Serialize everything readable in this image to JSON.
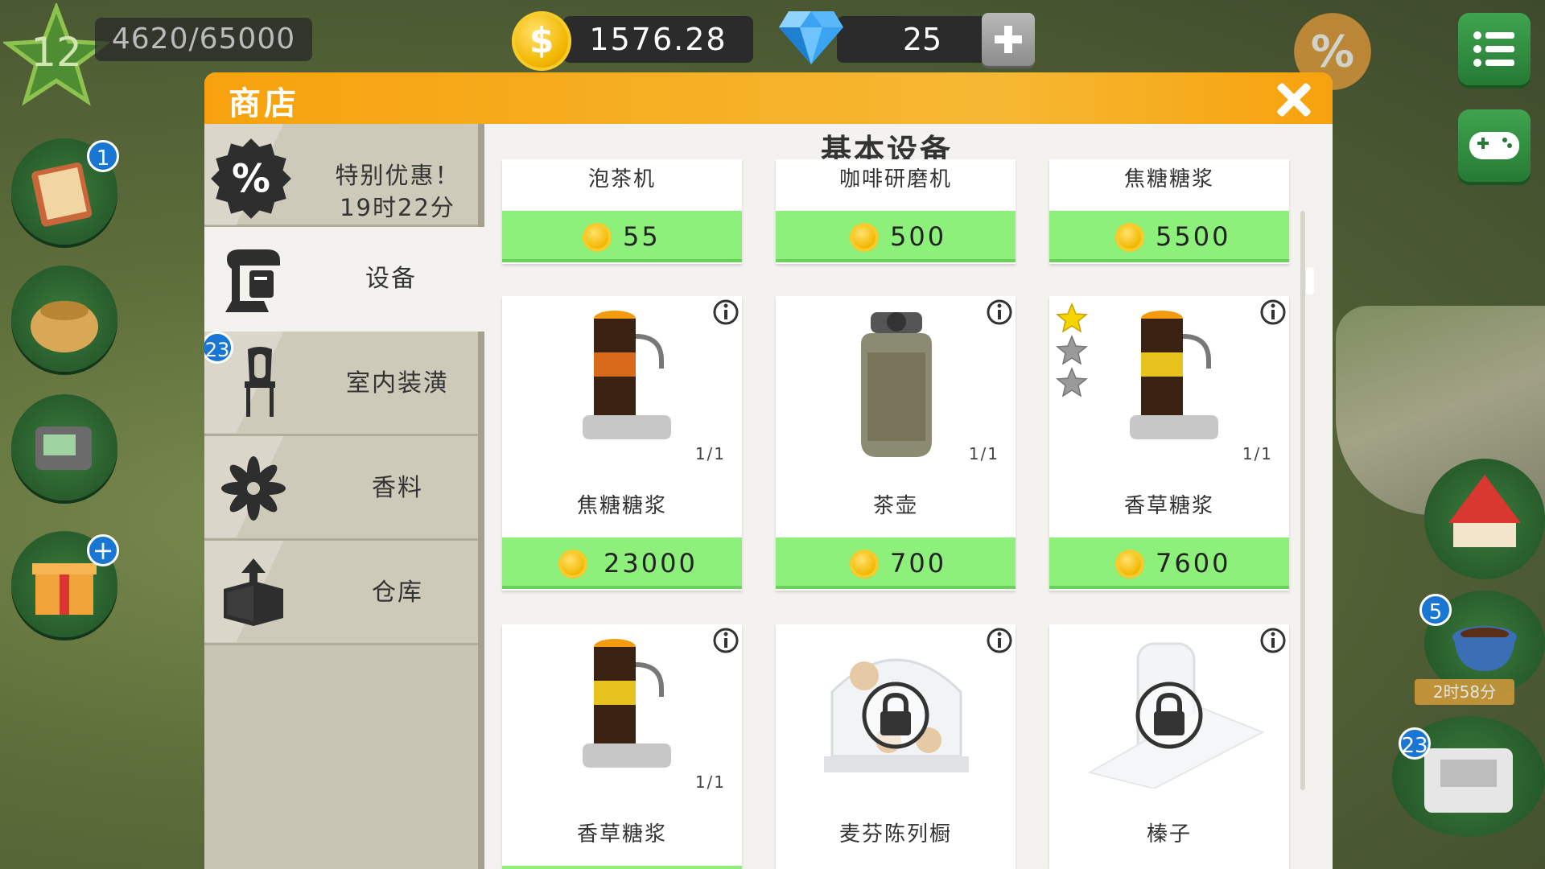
{
  "hud": {
    "level": "12",
    "xp": "4620/65000",
    "coins": "1576.28",
    "gems": "25",
    "coin_symbol": "$"
  },
  "side_badges": {
    "recipe_book": "1",
    "interior": "23",
    "coffee": "5",
    "register": "23",
    "coffee_timer": "2时58分"
  },
  "shop": {
    "title": "商店",
    "section_title": "基本设备",
    "nav": {
      "promo_label": "特别优惠！",
      "promo_timer": "19时22分",
      "equipment": "设备",
      "interior": "室内装潢",
      "spices": "香料",
      "storage": "仓库",
      "interior_badge": "23"
    },
    "row1": [
      {
        "name": "泡茶机",
        "price": "55"
      },
      {
        "name": "咖啡研磨机",
        "price": "500"
      },
      {
        "name": "焦糖糖浆",
        "price": "5500"
      }
    ],
    "row2": [
      {
        "name": "焦糖糖浆",
        "price": "23000",
        "count": "1/1"
      },
      {
        "name": "茶壶",
        "price": "700",
        "count": "1/1"
      },
      {
        "name": "香草糖浆",
        "price": "7600",
        "count": "1/1",
        "stars_filled": 1,
        "stars_total": 3
      }
    ],
    "row3": [
      {
        "name": "香草糖浆",
        "count": "1/1"
      },
      {
        "name": "麦芬陈列橱"
      },
      {
        "name": "榛子"
      }
    ]
  },
  "colors": {
    "header_orange": "#f7a20d",
    "price_green": "#8cf07a",
    "badge_blue": "#1976d2"
  }
}
